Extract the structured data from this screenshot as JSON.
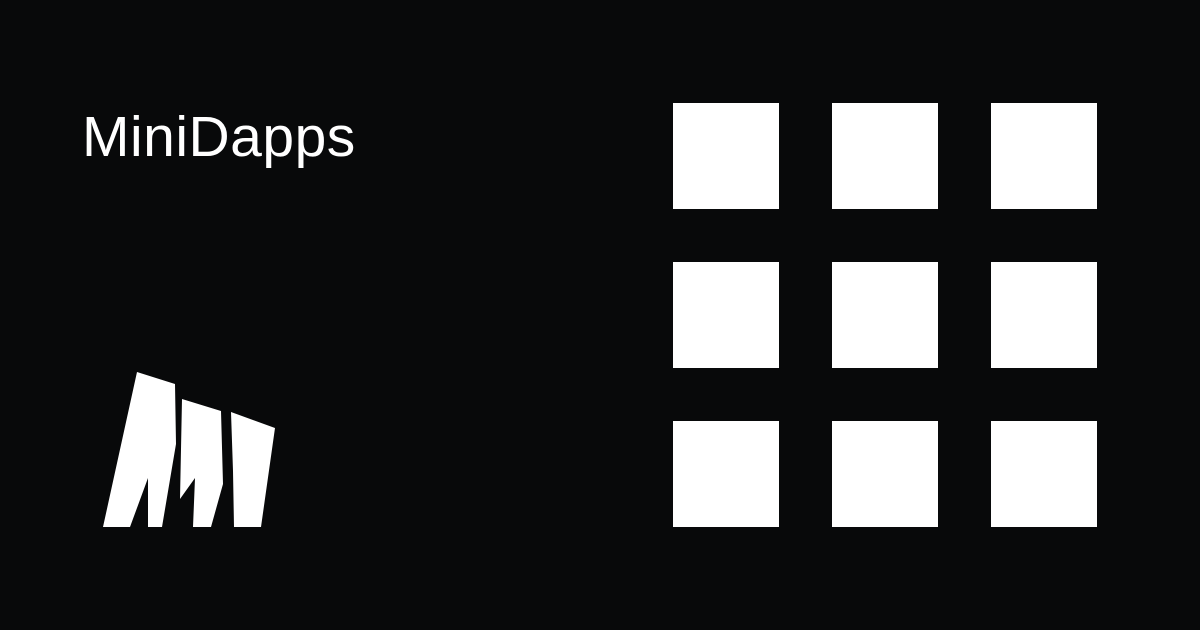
{
  "brand": {
    "name": "MiniDapps",
    "logo_icon": "minidapps-logo-icon"
  },
  "colors": {
    "background": "#08090a",
    "foreground": "#ffffff"
  },
  "app_grid": {
    "rows": 3,
    "columns": 3,
    "tile_icon": "square-tile"
  }
}
